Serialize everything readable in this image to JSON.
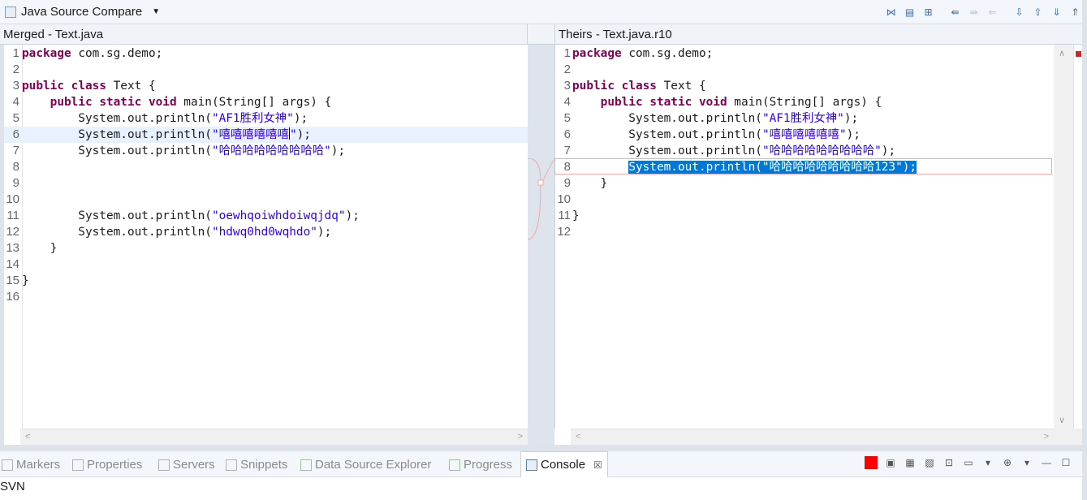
{
  "toolbar": {
    "title": "Java Source Compare",
    "icons": [
      "ignore-whitespace-icon",
      "show-ancestor-icon",
      "two-way-compare-icon",
      "copy-all-left-icon",
      "copy-all-right-icon",
      "copy-current-change-icon",
      "next-difference-icon",
      "previous-difference-icon",
      "next-change-icon",
      "previous-change-icon"
    ]
  },
  "left_pane": {
    "title": "Merged - Text.java",
    "lines": [
      {
        "n": "1",
        "segs": [
          {
            "t": "package",
            "c": "kw"
          },
          {
            "t": " com.sg.demo;",
            "c": ""
          }
        ]
      },
      {
        "n": "2",
        "segs": []
      },
      {
        "n": "3",
        "segs": [
          {
            "t": "public",
            "c": "kw"
          },
          {
            "t": " ",
            "c": ""
          },
          {
            "t": "class",
            "c": "kw"
          },
          {
            "t": " Text {",
            "c": ""
          }
        ]
      },
      {
        "n": "4",
        "segs": [
          {
            "t": "    ",
            "c": ""
          },
          {
            "t": "public",
            "c": "kw"
          },
          {
            "t": " ",
            "c": ""
          },
          {
            "t": "static",
            "c": "kw"
          },
          {
            "t": " ",
            "c": ""
          },
          {
            "t": "void",
            "c": "kw"
          },
          {
            "t": " main(String[] args) {",
            "c": ""
          }
        ]
      },
      {
        "n": "5",
        "segs": [
          {
            "t": "        System.out.println(",
            "c": ""
          },
          {
            "t": "\"AF1胜利女神\"",
            "c": "str"
          },
          {
            "t": ");",
            "c": ""
          }
        ]
      },
      {
        "n": "6",
        "segs": [
          {
            "t": "        System.out.println(",
            "c": ""
          },
          {
            "t": "\"嘻嘻嘻嘻嘻嘻",
            "c": "str"
          },
          {
            "t": "|",
            "c": "caret"
          },
          {
            "t": "\"",
            "c": "str"
          },
          {
            "t": ");",
            "c": ""
          }
        ]
      },
      {
        "n": "7",
        "segs": [
          {
            "t": "        System.out.println(",
            "c": ""
          },
          {
            "t": "\"哈哈哈哈哈哈哈哈哈\"",
            "c": "str"
          },
          {
            "t": ");",
            "c": ""
          }
        ]
      },
      {
        "n": "8",
        "segs": []
      },
      {
        "n": "9",
        "segs": []
      },
      {
        "n": "10",
        "segs": []
      },
      {
        "n": "11",
        "segs": [
          {
            "t": "        System.out.println(",
            "c": ""
          },
          {
            "t": "\"oewhqoiwhdoiwqjdq\"",
            "c": "str"
          },
          {
            "t": ");",
            "c": ""
          }
        ]
      },
      {
        "n": "12",
        "segs": [
          {
            "t": "        System.out.println(",
            "c": ""
          },
          {
            "t": "\"hdwq0hd0wqhdo\"",
            "c": "str"
          },
          {
            "t": ");",
            "c": ""
          }
        ]
      },
      {
        "n": "13",
        "segs": [
          {
            "t": "    }",
            "c": ""
          }
        ]
      },
      {
        "n": "14",
        "segs": []
      },
      {
        "n": "15",
        "segs": [
          {
            "t": "}",
            "c": ""
          }
        ]
      },
      {
        "n": "16",
        "segs": []
      }
    ]
  },
  "right_pane": {
    "title": "Theirs - Text.java.r10",
    "lines": [
      {
        "n": "1",
        "segs": [
          {
            "t": "package",
            "c": "kw"
          },
          {
            "t": " com.sg.demo;",
            "c": ""
          }
        ]
      },
      {
        "n": "2",
        "segs": []
      },
      {
        "n": "3",
        "segs": [
          {
            "t": "public",
            "c": "kw"
          },
          {
            "t": " ",
            "c": ""
          },
          {
            "t": "class",
            "c": "kw"
          },
          {
            "t": " Text {",
            "c": ""
          }
        ]
      },
      {
        "n": "4",
        "segs": [
          {
            "t": "    ",
            "c": ""
          },
          {
            "t": "public",
            "c": "kw"
          },
          {
            "t": " ",
            "c": ""
          },
          {
            "t": "static",
            "c": "kw"
          },
          {
            "t": " ",
            "c": ""
          },
          {
            "t": "void",
            "c": "kw"
          },
          {
            "t": " main(String[] args) {",
            "c": ""
          }
        ]
      },
      {
        "n": "5",
        "segs": [
          {
            "t": "        System.out.println(",
            "c": ""
          },
          {
            "t": "\"AF1胜利女神\"",
            "c": "str"
          },
          {
            "t": ");",
            "c": ""
          }
        ]
      },
      {
        "n": "6",
        "segs": [
          {
            "t": "        System.out.println(",
            "c": ""
          },
          {
            "t": "\"嘻嘻嘻嘻嘻嘻\"",
            "c": "str"
          },
          {
            "t": ");",
            "c": ""
          }
        ]
      },
      {
        "n": "7",
        "segs": [
          {
            "t": "        System.out.println(",
            "c": ""
          },
          {
            "t": "\"哈哈哈哈哈哈哈哈哈\"",
            "c": "str"
          },
          {
            "t": ");",
            "c": ""
          }
        ]
      },
      {
        "n": "8",
        "segs": [
          {
            "t": "        ",
            "c": ""
          },
          {
            "t": "System.out.println(\"哈哈哈哈哈哈哈哈哈123\");",
            "c": "sel"
          }
        ]
      },
      {
        "n": "9",
        "segs": [
          {
            "t": "    }",
            "c": ""
          }
        ]
      },
      {
        "n": "10",
        "segs": []
      },
      {
        "n": "11",
        "segs": [
          {
            "t": "}",
            "c": ""
          }
        ]
      },
      {
        "n": "12",
        "segs": []
      }
    ]
  },
  "bottom": {
    "tabs": [
      {
        "label": "Markers",
        "icon": "markers-icon"
      },
      {
        "label": "Properties",
        "icon": "properties-icon"
      },
      {
        "label": "Servers",
        "icon": "servers-icon"
      },
      {
        "label": "Snippets",
        "icon": "snippets-icon"
      },
      {
        "label": "Data Source Explorer",
        "icon": "data-source-explorer-icon"
      },
      {
        "label": "Progress",
        "icon": "progress-icon"
      },
      {
        "label": "Console",
        "icon": "console-icon"
      }
    ],
    "active_tab": "Console",
    "close_glyph": "☒",
    "console_output": "SVN"
  },
  "colors": {
    "keyword": "#7f0055",
    "string": "#2a00ff",
    "selection": "#0078d7",
    "diff_border": "#f1a9a9",
    "diff_fill": "#fef2f2",
    "stop": "#ff0000"
  }
}
